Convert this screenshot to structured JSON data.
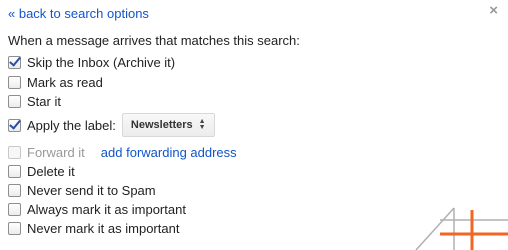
{
  "header": {
    "back_link": "« back to search options",
    "close_glyph": "×"
  },
  "intro_text": "When a message arrives that matches this search:",
  "options": {
    "skip_inbox": {
      "label": "Skip the Inbox (Archive it)",
      "checked": true
    },
    "mark_read": {
      "label": "Mark as read",
      "checked": false
    },
    "star_it": {
      "label": "Star it",
      "checked": false
    },
    "apply_label": {
      "label": "Apply the label:",
      "checked": true,
      "selected_value": "Newsletters"
    },
    "forward_it": {
      "label": "Forward it",
      "checked": false,
      "disabled": true,
      "link": "add forwarding address"
    },
    "delete_it": {
      "label": "Delete it",
      "checked": false
    },
    "never_spam": {
      "label": "Never send it to Spam",
      "checked": false
    },
    "always_important": {
      "label": "Always mark it as important",
      "checked": false
    },
    "never_important": {
      "label": "Never mark it as important",
      "checked": false
    }
  },
  "colors": {
    "link": "#1155cc",
    "watermark_accent": "#f26522",
    "watermark_line": "#b0b0b0"
  },
  "icons": {
    "close": "close-icon",
    "select_arrows": "up-down-arrows-icon",
    "watermark": "logo-watermark"
  }
}
